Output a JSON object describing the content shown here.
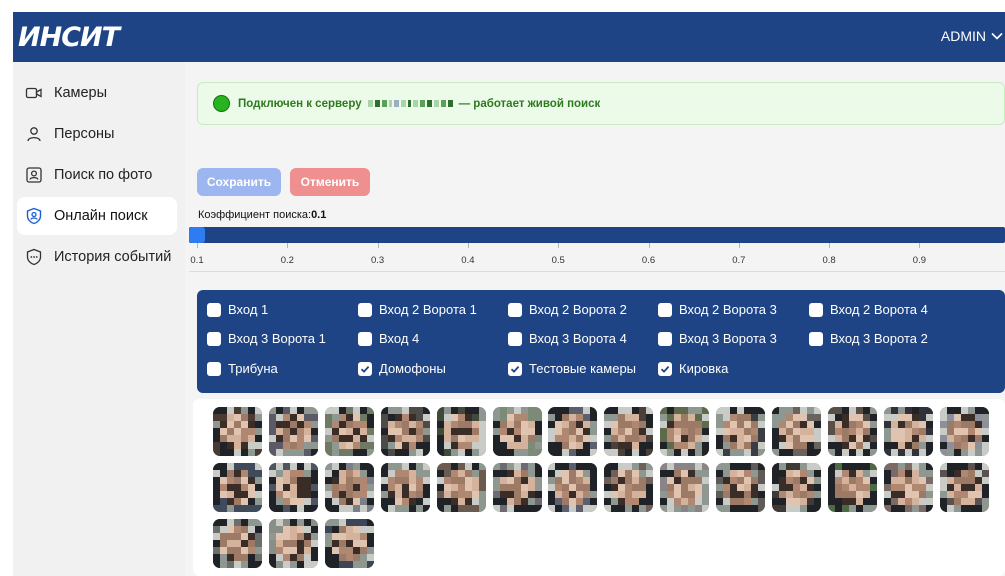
{
  "header": {
    "logo": "ИНСИТ",
    "user": "ADMIN",
    "user_icon": "chevron-down-icon"
  },
  "sidebar": {
    "items": [
      {
        "label": "Камеры",
        "icon": "camera-icon",
        "active": false
      },
      {
        "label": "Персоны",
        "icon": "person-icon",
        "active": false
      },
      {
        "label": "Поиск по фото",
        "icon": "photo-search-icon",
        "active": false
      },
      {
        "label": "Онлайн поиск",
        "icon": "shield-user-icon",
        "active": true
      },
      {
        "label": "История событий",
        "icon": "shield-history-icon",
        "active": false
      }
    ]
  },
  "status": {
    "prefix": "Подключен к серверу",
    "suffix": "— работает живой поиск",
    "indicator_color": "#26b51e"
  },
  "actions": {
    "save_label": "Сохранить",
    "cancel_label": "Отменить"
  },
  "search_coefficient": {
    "label": "Коэффициент поиска:",
    "value": "0.1",
    "min": 0.1,
    "max": 1.0,
    "ticks": [
      "0.1",
      "0.2",
      "0.3",
      "0.4",
      "0.5",
      "0.6",
      "0.7",
      "0.8",
      "0.9"
    ]
  },
  "cameras": [
    {
      "label": "Вход 1",
      "checked": false
    },
    {
      "label": "Вход 2 Ворота 1",
      "checked": false
    },
    {
      "label": "Вход 2 Ворота 2",
      "checked": false
    },
    {
      "label": "Вход 2 Ворота 3",
      "checked": false
    },
    {
      "label": "Вход 2 Ворота 4",
      "checked": false
    },
    {
      "label": "Вход 3 Ворота 1",
      "checked": false
    },
    {
      "label": "Вход 4",
      "checked": false
    },
    {
      "label": "Вход 3 Ворота 4",
      "checked": false
    },
    {
      "label": "Вход 3 Ворота 3",
      "checked": false
    },
    {
      "label": "Вход 3 Ворота 2",
      "checked": false
    },
    {
      "label": "Трибуна",
      "checked": false
    },
    {
      "label": "Домофоны",
      "checked": true
    },
    {
      "label": "Тестовые камеры",
      "checked": true
    },
    {
      "label": "Кировка",
      "checked": true
    }
  ],
  "faces": {
    "count": 31,
    "tints": [
      "#6b6f6a",
      "#8a8f86",
      "#3c4656",
      "#4a3a34",
      "#5c5a66",
      "#6e7a64",
      "#4d4a48",
      "#3f4a3a",
      "#7d8a78",
      "#5b5f6e",
      "#4b3f3a",
      "#5d6b4c",
      "#3a3e44",
      "#6a625c",
      "#5a4e48",
      "#2f3238",
      "#8c8f9c",
      "#3f4b5a",
      "#4f5560",
      "#7a7f88",
      "#4a5546",
      "#6a5a50",
      "#6c6a72",
      "#5a6070",
      "#6e6058",
      "#8a8486",
      "#5e5a58",
      "#3e3a38",
      "#4e6a44",
      "#7c6a66",
      "#5a5250"
    ]
  }
}
